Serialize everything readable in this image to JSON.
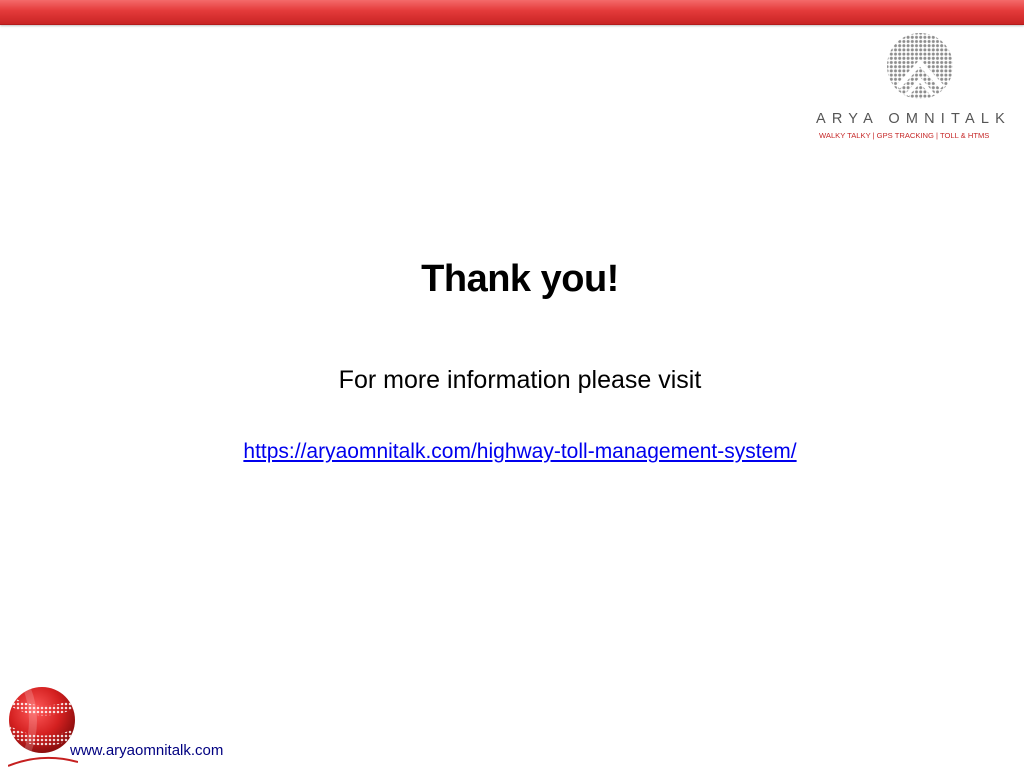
{
  "slide": {
    "title": "Thank you!",
    "info_text": "For more information please visit",
    "link_text": "https://aryaomnitalk.com/highway-toll-management-system/"
  },
  "logo": {
    "company_name": "ARYA OMNITALK",
    "tagline": "WALKY TALKY | GPS TRACKING | TOLL & HTMS",
    "icon": "arya-omnitalk-logo-icon"
  },
  "footer": {
    "url": "www.aryaomnitalk.com",
    "icon": "red-globe-icon"
  },
  "colors": {
    "accent": "#e43a3a",
    "link": "#0000ee",
    "logo_gray": "#888888",
    "tagline_red": "#c62828",
    "footer_url": "#000080"
  }
}
